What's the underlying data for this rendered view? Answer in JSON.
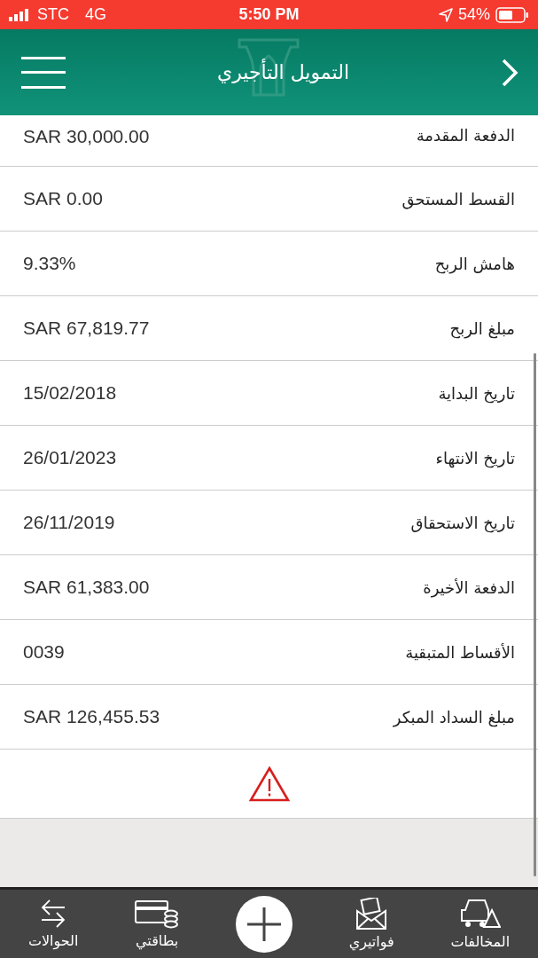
{
  "status_bar": {
    "carrier": "STC",
    "network": "4G",
    "time": "5:50 PM",
    "battery": "54%"
  },
  "header": {
    "title": "التمويل التأجيري"
  },
  "rows": [
    {
      "label": "الدفعة المقدمة",
      "value": "SAR 30,000.00"
    },
    {
      "label": "القسط المستحق",
      "value": "SAR 0.00"
    },
    {
      "label": "هامش الربح",
      "value": "9.33%"
    },
    {
      "label": "مبلغ الربح",
      "value": "SAR 67,819.77"
    },
    {
      "label": "تاريخ البداية",
      "value": "15/02/2018"
    },
    {
      "label": "تاريخ الانتهاء",
      "value": "26/01/2023"
    },
    {
      "label": "تاريخ الاستحقاق",
      "value": "26/11/2019"
    },
    {
      "label": "الدفعة الأخيرة",
      "value": "SAR 61,383.00"
    },
    {
      "label": "الأقساط المتبقية",
      "value": "0039"
    },
    {
      "label": "مبلغ السداد المبكر",
      "value": "SAR 126,455.53"
    }
  ],
  "tab_bar": [
    {
      "kind": "violations",
      "label": "المخالفات"
    },
    {
      "kind": "bills",
      "label": "فواتيري"
    },
    {
      "kind": "add"
    },
    {
      "kind": "card",
      "label": "بطاقتي"
    },
    {
      "kind": "transfer",
      "label": "الحوالات"
    }
  ]
}
